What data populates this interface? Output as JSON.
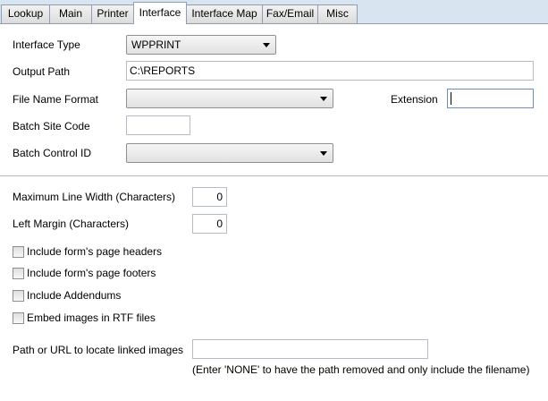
{
  "tabs": [
    "Lookup",
    "Main",
    "Printer",
    "Interface",
    "Interface Map",
    "Fax/Email",
    "Misc"
  ],
  "active_tab": "Interface",
  "form": {
    "interface_type_label": "Interface Type",
    "interface_type_value": "WPPRINT",
    "output_path_label": "Output Path",
    "output_path_value": "C:\\REPORTS",
    "file_name_format_label": "File Name Format",
    "file_name_format_value": "",
    "extension_label": "Extension",
    "extension_value": "",
    "batch_site_code_label": "Batch Site Code",
    "batch_site_code_value": "",
    "batch_control_id_label": "Batch Control ID",
    "batch_control_id_value": "",
    "max_line_width_label": "Maximum Line Width (Characters)",
    "max_line_width_value": "0",
    "left_margin_label": "Left Margin (Characters)",
    "left_margin_value": "0",
    "checkboxes": [
      {
        "label": "Include form's page headers",
        "checked": false
      },
      {
        "label": "Include form's page footers",
        "checked": false
      },
      {
        "label": "Include Addendums",
        "checked": false
      },
      {
        "label": "Embed images in RTF files",
        "checked": false
      }
    ],
    "linked_images_label": "Path or URL to locate linked images",
    "linked_images_value": "",
    "linked_images_hint": "(Enter 'NONE' to have the path removed and only include the filename)"
  }
}
